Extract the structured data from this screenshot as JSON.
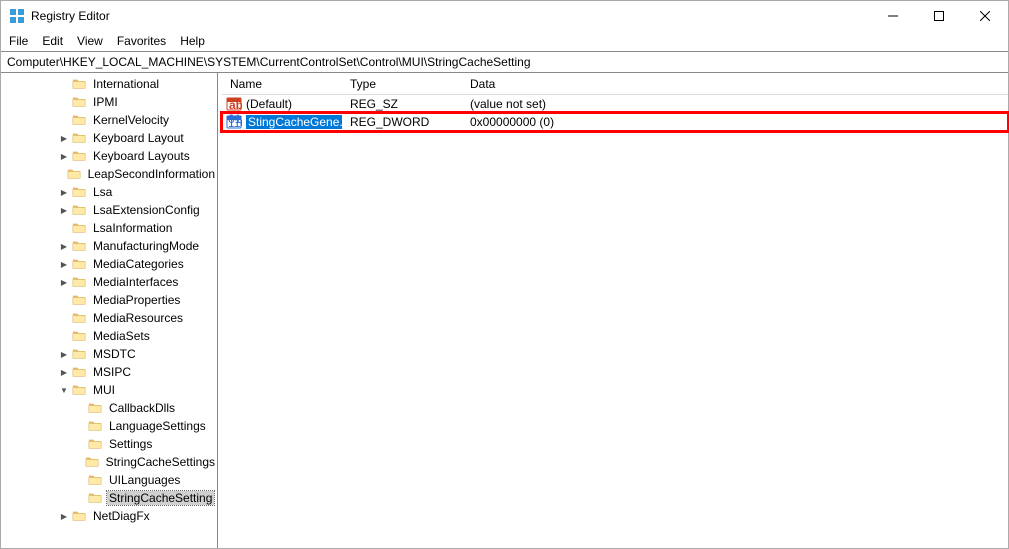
{
  "titlebar": {
    "title": "Registry Editor"
  },
  "menu": {
    "file": "File",
    "edit": "Edit",
    "view": "View",
    "favorites": "Favorites",
    "help": "Help"
  },
  "address": "Computer\\HKEY_LOCAL_MACHINE\\SYSTEM\\CurrentControlSet\\Control\\MUI\\StringCacheSetting",
  "tree": [
    {
      "indent": 4,
      "exp": "",
      "label": "International"
    },
    {
      "indent": 4,
      "exp": "",
      "label": "IPMI"
    },
    {
      "indent": 4,
      "exp": "",
      "label": "KernelVelocity"
    },
    {
      "indent": 4,
      "exp": ">",
      "label": "Keyboard Layout"
    },
    {
      "indent": 4,
      "exp": ">",
      "label": "Keyboard Layouts"
    },
    {
      "indent": 4,
      "exp": "",
      "label": "LeapSecondInformation"
    },
    {
      "indent": 4,
      "exp": ">",
      "label": "Lsa"
    },
    {
      "indent": 4,
      "exp": ">",
      "label": "LsaExtensionConfig"
    },
    {
      "indent": 4,
      "exp": "",
      "label": "LsaInformation"
    },
    {
      "indent": 4,
      "exp": ">",
      "label": "ManufacturingMode"
    },
    {
      "indent": 4,
      "exp": ">",
      "label": "MediaCategories"
    },
    {
      "indent": 4,
      "exp": ">",
      "label": "MediaInterfaces"
    },
    {
      "indent": 4,
      "exp": "",
      "label": "MediaProperties"
    },
    {
      "indent": 4,
      "exp": "",
      "label": "MediaResources"
    },
    {
      "indent": 4,
      "exp": "",
      "label": "MediaSets"
    },
    {
      "indent": 4,
      "exp": ">",
      "label": "MSDTC"
    },
    {
      "indent": 4,
      "exp": ">",
      "label": "MSIPC"
    },
    {
      "indent": 4,
      "exp": "v",
      "label": "MUI"
    },
    {
      "indent": 5,
      "exp": "",
      "label": "CallbackDlls"
    },
    {
      "indent": 5,
      "exp": "",
      "label": "LanguageSettings"
    },
    {
      "indent": 5,
      "exp": "",
      "label": "Settings"
    },
    {
      "indent": 5,
      "exp": "",
      "label": "StringCacheSettings"
    },
    {
      "indent": 5,
      "exp": "",
      "label": "UILanguages"
    },
    {
      "indent": 5,
      "exp": "",
      "label": "StringCacheSetting",
      "selected": true
    },
    {
      "indent": 4,
      "exp": ">",
      "label": "NetDiagFx"
    }
  ],
  "list": {
    "columns": {
      "name": "Name",
      "type": "Type",
      "data": "Data"
    },
    "rows": [
      {
        "icon": "ab",
        "name": "(Default)",
        "type": "REG_SZ",
        "data": "(value not set)"
      },
      {
        "icon": "bin",
        "name": "StingCacheGene...",
        "type": "REG_DWORD",
        "data": "0x00000000 (0)",
        "selected": true,
        "highlight": true
      }
    ]
  }
}
